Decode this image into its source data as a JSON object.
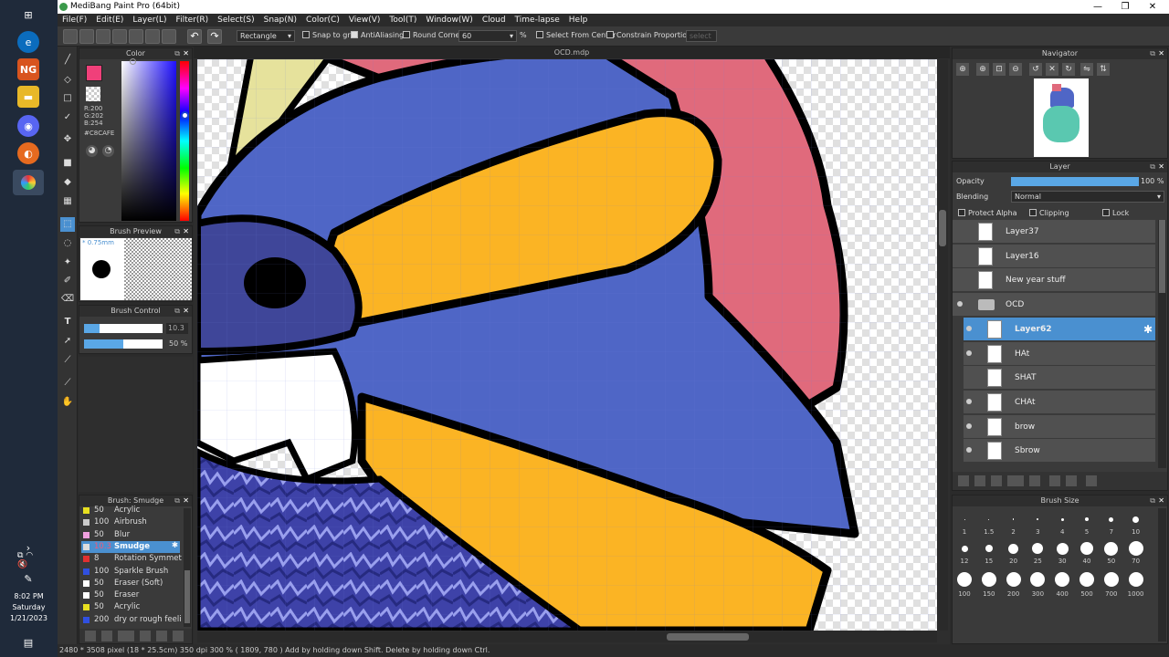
{
  "window": {
    "title": "MediBang Paint Pro (64bit)"
  },
  "menu": [
    "File(F)",
    "Edit(E)",
    "Layer(L)",
    "Filter(R)",
    "Select(S)",
    "Snap(N)",
    "Color(C)",
    "View(V)",
    "Tool(T)",
    "Window(W)",
    "Cloud",
    "Time-lapse",
    "Help"
  ],
  "toolbar": {
    "shape": "Rectangle",
    "snap_to_grid": "Snap to grid",
    "antialiasing": "AntiAliasing",
    "round_corners": "Round Corners",
    "round_value": "60",
    "percent": "%",
    "select_from_center": "Select From Center",
    "constrain": "Constrain Proportions",
    "apply": "select"
  },
  "color_panel": {
    "title": "Color",
    "r": "R:200",
    "g": "G:202",
    "b": "B:254",
    "hex": "#C8CAFE",
    "fg": "#f0407a"
  },
  "brush_preview": {
    "title": "Brush Preview",
    "size": "* 0.75mm"
  },
  "brush_control": {
    "title": "Brush Control",
    "size_value": "10.3",
    "opacity_value": "50 %",
    "size_fill": 0.2,
    "opacity_fill": 0.5
  },
  "brush_panel": {
    "title": "Brush: Smudge",
    "items": [
      {
        "size": "50",
        "name": "Acrylic",
        "color": "#e8e020"
      },
      {
        "size": "100",
        "name": "Airbrush",
        "color": "#cccccc"
      },
      {
        "size": "50",
        "name": "Blur",
        "color": "#f0a0e0"
      },
      {
        "size": "10.3",
        "name": "Smudge",
        "color": "#dddddd"
      },
      {
        "size": "8",
        "name": "Rotation Symmetry",
        "color": "#e03030"
      },
      {
        "size": "100",
        "name": "Sparkle Brush",
        "color": "#3050e0"
      },
      {
        "size": "50",
        "name": "Eraser (Soft)",
        "color": "#ffffff"
      },
      {
        "size": "50",
        "name": "Eraser",
        "color": "#ffffff"
      },
      {
        "size": "50",
        "name": "Acrylic",
        "color": "#e8e020"
      },
      {
        "size": "200",
        "name": "dry or rough feeling",
        "color": "#3050e0"
      }
    ]
  },
  "document": {
    "tab": "OCD.mdp"
  },
  "navigator": {
    "title": "Navigator"
  },
  "layer_panel": {
    "title": "Layer",
    "opacity_label": "Opacity",
    "opacity_value": "100 %",
    "blending_label": "Blending",
    "blending_value": "Normal",
    "protect_alpha": "Protect Alpha",
    "clipping": "Clipping",
    "lock": "Lock",
    "layers": [
      {
        "name": "Layer37"
      },
      {
        "name": "Layer16"
      },
      {
        "name": "New year stuff"
      },
      {
        "name": "OCD"
      },
      {
        "name": "Layer62"
      },
      {
        "name": "HAt"
      },
      {
        "name": "SHAT"
      },
      {
        "name": "CHAt"
      },
      {
        "name": "brow"
      },
      {
        "name": "Sbrow"
      }
    ]
  },
  "brush_size_panel": {
    "title": "Brush Size",
    "row1": [
      "1",
      "1.5",
      "2",
      "3",
      "4",
      "5",
      "7",
      "10"
    ],
    "row2": [
      "12",
      "15",
      "20",
      "25",
      "30",
      "40",
      "50",
      "70"
    ],
    "row3": [
      "100",
      "150",
      "200",
      "300",
      "400",
      "500",
      "700",
      "1000"
    ]
  },
  "status": {
    "text": "2480 * 3508 pixel  (18 * 25.5cm)  350 dpi  300 %  ( 1809, 780 )  Add by holding down Shift. Delete by holding down Ctrl."
  },
  "clock": {
    "time": "8:02 PM",
    "day": "Saturday",
    "date": "1/21/2023"
  }
}
